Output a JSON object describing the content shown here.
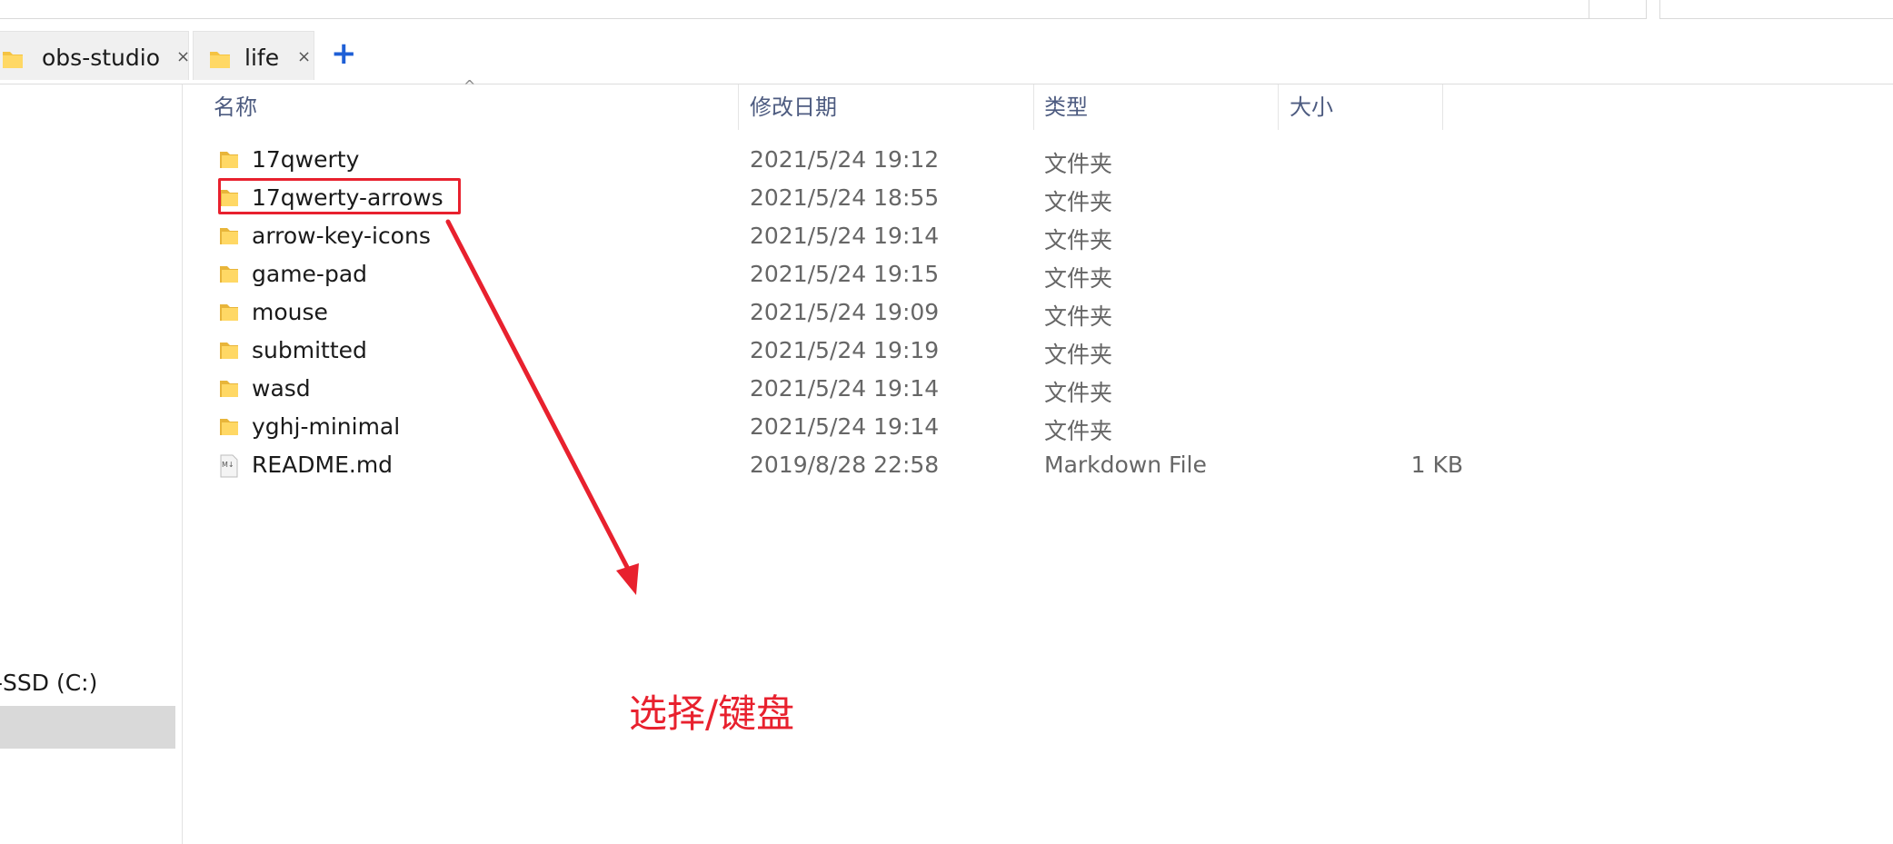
{
  "tabs": [
    {
      "label": "obs-studio",
      "close": "×"
    },
    {
      "label": "life",
      "close": "×"
    }
  ],
  "new_tab_label": "+",
  "nav": {
    "drive_label": "-SSD (C:)"
  },
  "columns": {
    "name": "名称",
    "date": "修改日期",
    "type": "类型",
    "size": "大小"
  },
  "files": [
    {
      "name": "17qwerty",
      "date": "2021/5/24 19:12",
      "type": "文件夹",
      "size": "",
      "icon": "folder-icon"
    },
    {
      "name": "17qwerty-arrows",
      "date": "2021/5/24 18:55",
      "type": "文件夹",
      "size": "",
      "icon": "folder-icon"
    },
    {
      "name": "arrow-key-icons",
      "date": "2021/5/24 19:14",
      "type": "文件夹",
      "size": "",
      "icon": "folder-icon"
    },
    {
      "name": "game-pad",
      "date": "2021/5/24 19:15",
      "type": "文件夹",
      "size": "",
      "icon": "folder-icon"
    },
    {
      "name": "mouse",
      "date": "2021/5/24 19:09",
      "type": "文件夹",
      "size": "",
      "icon": "folder-icon"
    },
    {
      "name": "submitted",
      "date": "2021/5/24 19:19",
      "type": "文件夹",
      "size": "",
      "icon": "folder-icon"
    },
    {
      "name": "wasd",
      "date": "2021/5/24 19:14",
      "type": "文件夹",
      "size": "",
      "icon": "folder-icon"
    },
    {
      "name": "yghj-minimal",
      "date": "2021/5/24 19:14",
      "type": "文件夹",
      "size": "",
      "icon": "folder-icon"
    },
    {
      "name": "README.md",
      "date": "2019/8/28 22:58",
      "type": "Markdown File",
      "size": "1 KB",
      "icon": "markdown-file-icon"
    }
  ],
  "annotation": {
    "text": "选择/键盘",
    "color": "#e8212e"
  },
  "colors": {
    "accent": "#1e5fd6",
    "header_text": "#4d5b80",
    "folder": "#f5c342",
    "selection": "#d9d9d9"
  }
}
